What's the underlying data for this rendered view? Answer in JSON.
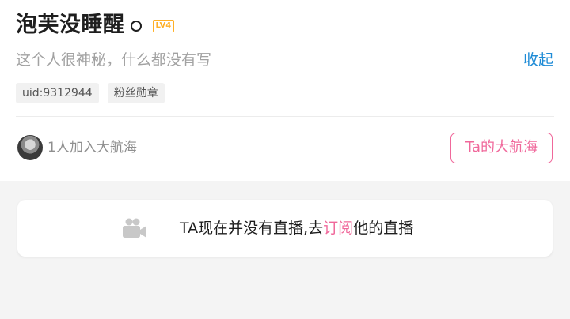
{
  "profile": {
    "username": "泡芙没睡醒",
    "level": "LV4",
    "signature": "这个人很神秘，什么都没有写",
    "collapse_label": "收起",
    "uid": "uid:9312944",
    "fan_medal": "粉丝勋章"
  },
  "fleet": {
    "count_text": "1人加入大航海",
    "button_label": "Ta的大航海"
  },
  "live": {
    "prefix": "TA现在并没有直播,去",
    "subscribe_link": "订阅",
    "suffix": "他的直播"
  },
  "colors": {
    "accent_pink": "#f0689b",
    "link_blue": "#1e8bd6",
    "level_orange": "#ffb027"
  },
  "icons": [
    "gender-icon",
    "camera-icon"
  ]
}
